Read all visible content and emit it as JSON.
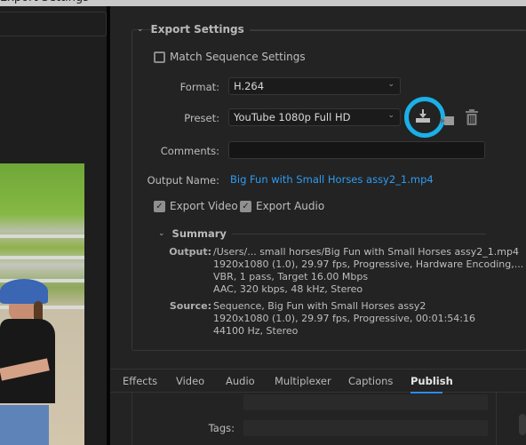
{
  "window": {
    "title": "Export Settings"
  },
  "export_settings": {
    "section_title": "Export Settings",
    "match_sequence": {
      "label": "Match Sequence Settings",
      "checked": false
    },
    "format": {
      "label": "Format:",
      "value": "H.264"
    },
    "preset": {
      "label": "Preset:",
      "value": "YouTube 1080p Full HD"
    },
    "preset_actions": {
      "save": "save-preset-icon",
      "import": "import-preset-icon",
      "delete": "delete-preset-icon"
    },
    "comments": {
      "label": "Comments:",
      "value": ""
    },
    "output_name": {
      "label": "Output Name:",
      "value": "Big Fun with Small Horses assy2_1.mp4"
    },
    "export_video": {
      "label": "Export Video",
      "checked": true
    },
    "export_audio": {
      "label": "Export Audio",
      "checked": true
    }
  },
  "summary": {
    "title": "Summary",
    "output": {
      "key": "Output:",
      "lines": [
        "/Users/... small horses/Big Fun with Small Horses assy2_1.mp4",
        "1920x1080 (1.0), 29.97 fps, Progressive, Hardware Encoding,...",
        "VBR, 1 pass, Target 16.00 Mbps",
        "AAC, 320 kbps, 48 kHz, Stereo"
      ]
    },
    "source": {
      "key": "Source:",
      "lines": [
        "Sequence, Big Fun with Small Horses assy2",
        "1920x1080 (1.0), 29.97 fps, Progressive, 00:01:54:16",
        "44100 Hz, Stereo"
      ]
    }
  },
  "tabs": [
    {
      "label": "Effects",
      "active": false
    },
    {
      "label": "Video",
      "active": false
    },
    {
      "label": "Audio",
      "active": false
    },
    {
      "label": "Multiplexer",
      "active": false
    },
    {
      "label": "Captions",
      "active": false
    },
    {
      "label": "Publish",
      "active": true
    }
  ],
  "publish": {
    "tags_label": "Tags:",
    "tags_value": ""
  },
  "colors": {
    "accent": "#2d8ceb",
    "link": "#2d9cf2",
    "highlight_ring": "#1ab0e8"
  }
}
